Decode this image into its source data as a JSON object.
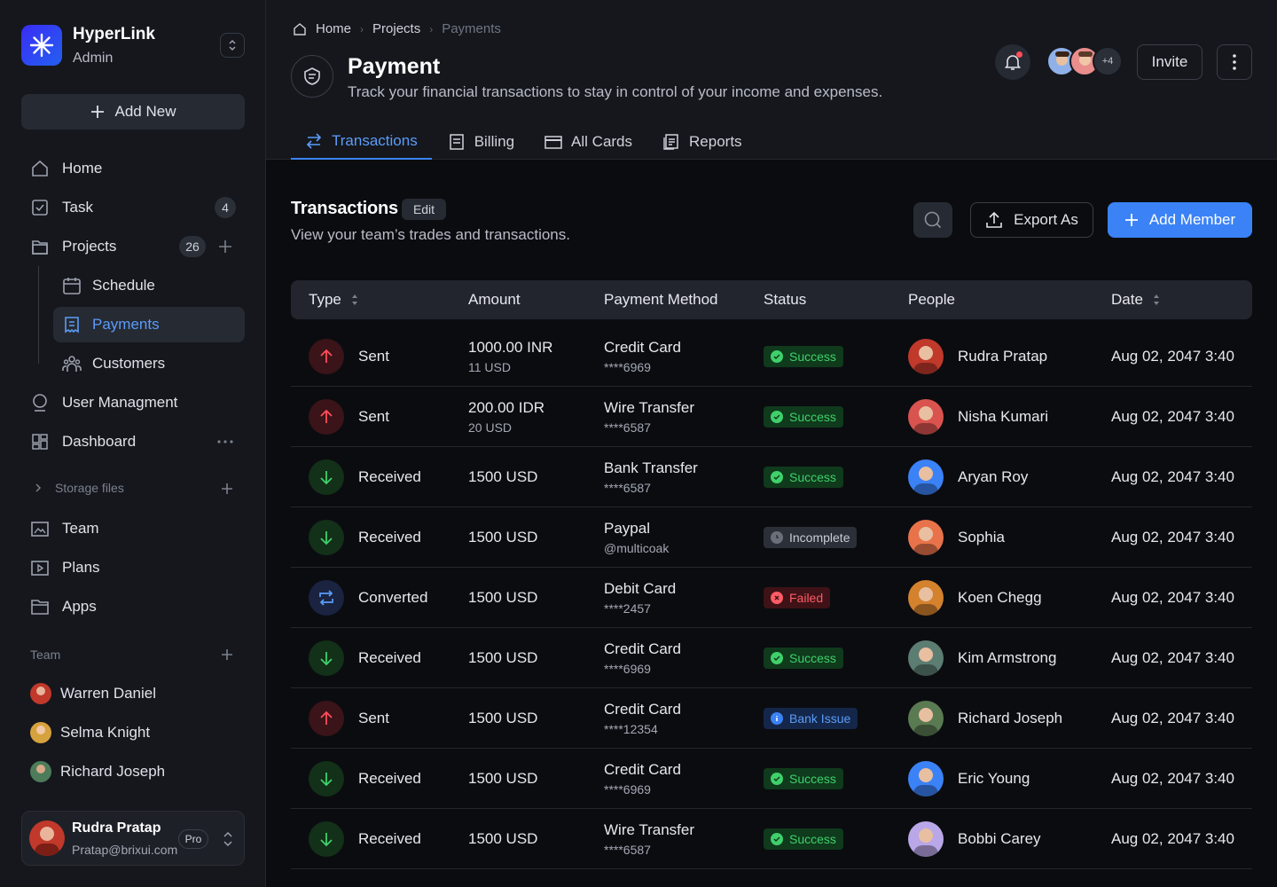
{
  "app": {
    "name": "HyperLink",
    "role": "Admin",
    "add_new": "Add New"
  },
  "sidebar": {
    "nav": [
      {
        "label": "Home",
        "icon": "home-icon"
      },
      {
        "label": "Task",
        "icon": "checkbox-icon",
        "count": "4"
      },
      {
        "label": "Projects",
        "icon": "folder-icon",
        "count": "26"
      },
      {
        "label": "Schedule",
        "icon": "calendar-icon"
      },
      {
        "label": "Payments",
        "icon": "payment-icon"
      },
      {
        "label": "Customers",
        "icon": "users-icon"
      },
      {
        "label": "User Managment",
        "icon": "user-circle-icon"
      },
      {
        "label": "Dashboard",
        "icon": "dashboard-icon"
      }
    ],
    "storage_label": "Storage files",
    "storage_items": [
      {
        "label": "Team",
        "icon": "image-folder-icon"
      },
      {
        "label": "Plans",
        "icon": "play-folder-icon"
      },
      {
        "label": "Apps",
        "icon": "apps-folder-icon"
      }
    ],
    "team_label": "Team",
    "team": [
      {
        "name": "Warren Daniel",
        "color": "#c0392b"
      },
      {
        "name": "Selma Knight",
        "color": "#d6a23e"
      },
      {
        "name": "Richard Joseph",
        "color": "#4d7c5a"
      }
    ],
    "user": {
      "name": "Rudra Pratap",
      "email": "Pratap@brixui.com",
      "plan": "Pro"
    }
  },
  "header": {
    "breadcrumb": [
      "Home",
      "Projects",
      "Payments"
    ],
    "title": "Payment",
    "subtitle": "Track your financial transactions to stay in control of your income and expenses.",
    "avatar_extra": "+4",
    "invite": "Invite",
    "tabs": [
      {
        "label": "Transactions",
        "icon": "transfer-icon"
      },
      {
        "label": "Billing",
        "icon": "billing-icon"
      },
      {
        "label": "All Cards",
        "icon": "card-icon"
      },
      {
        "label": "Reports",
        "icon": "reports-icon"
      }
    ]
  },
  "section": {
    "title": "Transactions",
    "edit": "Edit",
    "subtitle": "View your team’s trades and transactions.",
    "export": "Export As",
    "add_member": "Add Member"
  },
  "table": {
    "columns": [
      "Type",
      "Amount",
      "Payment Method",
      "Status",
      "People",
      "Date"
    ],
    "rows": [
      {
        "type": "Sent",
        "kind": "sent",
        "amount": "1000.00 INR",
        "amount_sub": "11 USD",
        "method": "Credit Card",
        "method_sub": "****6969",
        "status": "Success",
        "status_kind": "success",
        "person": "Rudra Pratap",
        "avatar_color": "#c0392b",
        "date": "Aug 02, 2047 3:40"
      },
      {
        "type": "Sent",
        "kind": "sent",
        "amount": "200.00 IDR",
        "amount_sub": "20 USD",
        "method": "Wire Transfer",
        "method_sub": "****6587",
        "status": "Success",
        "status_kind": "success",
        "person": "Nisha Kumari",
        "avatar_color": "#d9534f",
        "date": "Aug 02, 2047 3:40"
      },
      {
        "type": "Received",
        "kind": "received",
        "amount": "1500 USD",
        "amount_sub": "",
        "method": "Bank Transfer",
        "method_sub": "****6587",
        "status": "Success",
        "status_kind": "success",
        "person": "Aryan Roy",
        "avatar_color": "#3b82f6",
        "date": "Aug 02, 2047 3:40"
      },
      {
        "type": "Received",
        "kind": "received",
        "amount": "1500 USD",
        "amount_sub": "",
        "method": "Paypal",
        "method_sub": "@multicoak",
        "status": "Incomplete",
        "status_kind": "incomplete",
        "person": "Sophia",
        "avatar_color": "#e8734a",
        "date": "Aug 02, 2047 3:40"
      },
      {
        "type": "Converted",
        "kind": "converted",
        "amount": "1500 USD",
        "amount_sub": "",
        "method": "Debit Card",
        "method_sub": "****2457",
        "status": "Failed",
        "status_kind": "failed",
        "person": "Koen Chegg",
        "avatar_color": "#d4822e",
        "date": "Aug 02, 2047 3:40"
      },
      {
        "type": "Received",
        "kind": "received",
        "amount": "1500 USD",
        "amount_sub": "",
        "method": "Credit Card",
        "method_sub": "****6969",
        "status": "Success",
        "status_kind": "success",
        "person": "Kim Armstrong",
        "avatar_color": "#5c7d72",
        "date": "Aug 02, 2047 3:40"
      },
      {
        "type": "Sent",
        "kind": "sent",
        "amount": "1500 USD",
        "amount_sub": "",
        "method": "Credit Card",
        "method_sub": "****12354",
        "status": "Bank Issue",
        "status_kind": "info",
        "person": "Richard Joseph",
        "avatar_color": "#5a7a52",
        "date": "Aug 02, 2047 3:40"
      },
      {
        "type": "Received",
        "kind": "received",
        "amount": "1500 USD",
        "amount_sub": "",
        "method": "Credit Card",
        "method_sub": "****6969",
        "status": "Success",
        "status_kind": "success",
        "person": "Eric Young",
        "avatar_color": "#3b82f6",
        "date": "Aug 02, 2047 3:40"
      },
      {
        "type": "Received",
        "kind": "received",
        "amount": "1500 USD",
        "amount_sub": "",
        "method": "Wire Transfer",
        "method_sub": "****6587",
        "status": "Success",
        "status_kind": "success",
        "person": "Bobbi Carey",
        "avatar_color": "#b9a7e8",
        "date": "Aug 02, 2047 3:40"
      }
    ]
  },
  "colors": {
    "accent": "#3b82f6",
    "success": "#3fd06b",
    "failed": "#ff5c66"
  }
}
